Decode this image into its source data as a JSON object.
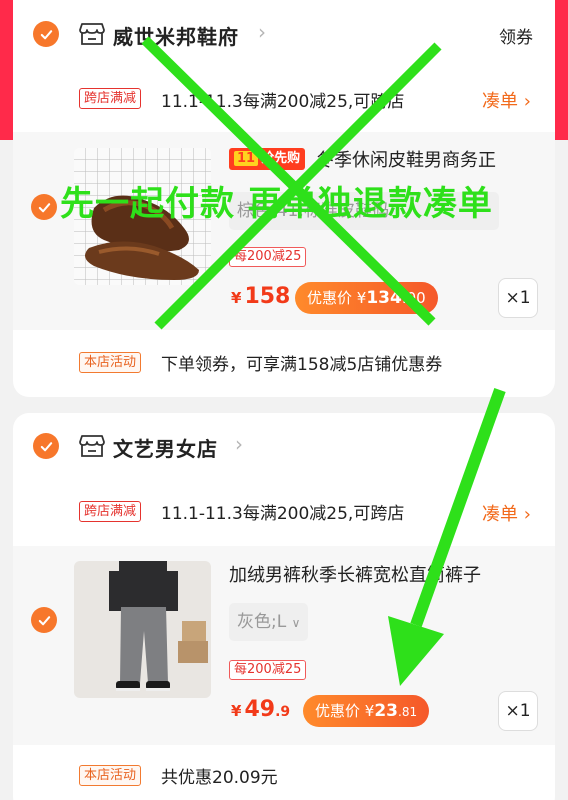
{
  "shops": [
    {
      "name": "威世米邦鞋府",
      "coupon_label": "领券",
      "promo": {
        "tag": "跨店满减",
        "text": "11.1-11.3每满200减25,可跨店",
        "link": "凑单"
      },
      "item": {
        "badge": "抢先购",
        "title": "冬季休闲皮鞋男商务正",
        "sku": "棕色;41;标准皮鞋码",
        "discount_tag": "每200减25",
        "price_int": "158",
        "price_dec": "",
        "coupon_label": "优惠价",
        "coupon_price": "134",
        "coupon_price_dec": ".00",
        "qty": "×1"
      },
      "activity": {
        "tag": "本店活动",
        "text": "下单领券，可享满158减5店铺优惠券"
      }
    },
    {
      "name": "文艺男女店",
      "promo": {
        "tag": "跨店满减",
        "text": "11.1-11.3每满200减25,可跨店",
        "link": "凑单"
      },
      "item": {
        "title": "加绒男裤秋季长裤宽松直筒裤子",
        "sku": "灰色;L",
        "discount_tag": "每200减25",
        "price_int": "49",
        "price_dec": ".9",
        "coupon_label": "优惠价",
        "coupon_price": "23",
        "coupon_price_dec": ".81",
        "qty": "×1"
      },
      "activity": {
        "tag": "本店活动",
        "text": "共优惠20.09元"
      }
    }
  ],
  "currency": "¥",
  "overlay_text": "先一起付款 再单独退款凑单",
  "colors": {
    "accent": "#f7772b",
    "price": "#f23a19",
    "overlay": "#2ee01a",
    "header": "#ff2a4a"
  }
}
